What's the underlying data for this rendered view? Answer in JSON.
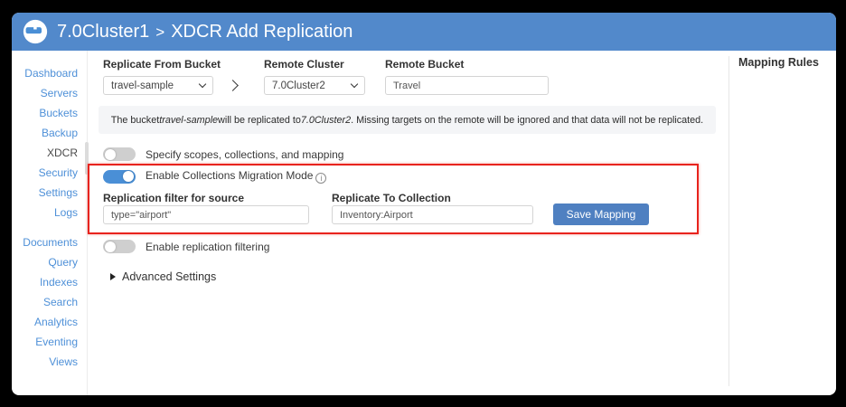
{
  "header": {
    "logo_icon": "couchbase-logo",
    "breadcrumb_cluster": "7.0Cluster1",
    "breadcrumb_separator": ">",
    "page_title": "XDCR Add Replication"
  },
  "sidebar": {
    "group1": [
      {
        "label": "Dashboard",
        "active": false
      },
      {
        "label": "Servers",
        "active": false
      },
      {
        "label": "Buckets",
        "active": false
      },
      {
        "label": "Backup",
        "active": false
      },
      {
        "label": "XDCR",
        "active": true
      },
      {
        "label": "Security",
        "active": false
      },
      {
        "label": "Settings",
        "active": false
      },
      {
        "label": "Logs",
        "active": false
      }
    ],
    "group2": [
      {
        "label": "Documents",
        "active": false
      },
      {
        "label": "Query",
        "active": false
      },
      {
        "label": "Indexes",
        "active": false
      },
      {
        "label": "Search",
        "active": false
      },
      {
        "label": "Analytics",
        "active": false
      },
      {
        "label": "Eventing",
        "active": false
      },
      {
        "label": "Views",
        "active": false
      }
    ]
  },
  "form": {
    "from_bucket": {
      "label": "Replicate From Bucket",
      "value": "travel-sample"
    },
    "remote_cluster": {
      "label": "Remote Cluster",
      "value": "7.0Cluster2"
    },
    "remote_bucket": {
      "label": "Remote Bucket",
      "value": "Travel"
    },
    "note": {
      "part1": "The bucket ",
      "bucket_italic": "travel-sample",
      "part2": " will be replicated to ",
      "cluster_italic": "7.0Cluster2",
      "part3": ". Missing targets on the remote will be ignored and that data will not be replicated."
    },
    "toggle_specify": {
      "label": "Specify scopes, collections, and mapping",
      "state": "off"
    },
    "toggle_migration": {
      "label": "Enable Collections Migration Mode",
      "state": "on",
      "info_icon": "i"
    },
    "toggle_filtering": {
      "label": "Enable replication filtering",
      "state": "off"
    },
    "filter_source": {
      "label": "Replication filter for source",
      "value": "type=\"airport\""
    },
    "to_collection": {
      "label": "Replicate To Collection",
      "value": "Inventory:Airport"
    },
    "save_button_label": "Save Mapping",
    "advanced_settings_label": "Advanced Settings"
  },
  "right_panel": {
    "title": "Mapping Rules"
  },
  "colors": {
    "header_bg": "#5289cb",
    "sidebar_link": "#4e90d8",
    "toggle_on": "#4a8fd6",
    "save_button": "#4f80c1",
    "highlight_red": "#e8231d",
    "note_bg": "#f4f5f7"
  }
}
